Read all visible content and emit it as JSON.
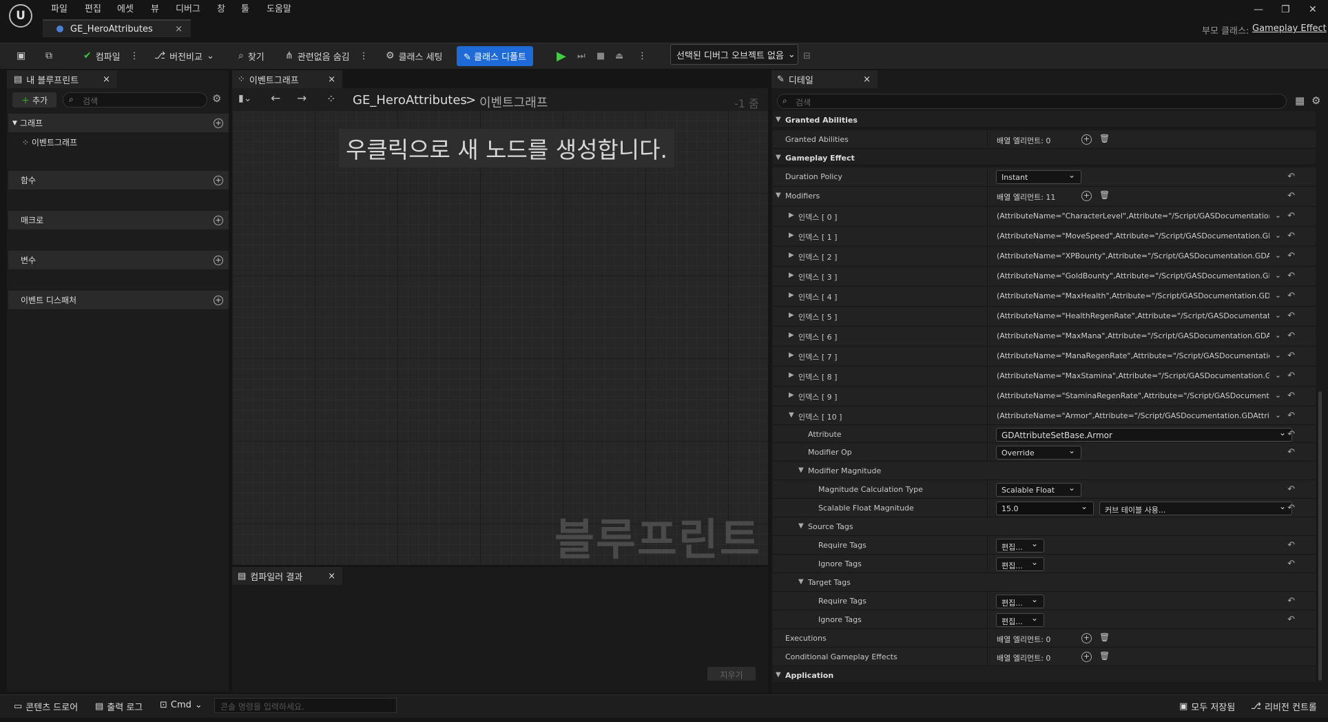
{
  "menu": [
    "파일",
    "편집",
    "에셋",
    "뷰",
    "디버그",
    "창",
    "툴",
    "도움말"
  ],
  "doc_tab": "GE_HeroAttributes",
  "parent_label": "부모 클래스:",
  "parent_value": "Gameplay Effect",
  "toolbar": {
    "compile": "컴파일",
    "diff": "버전비교",
    "find": "찾기",
    "hide_unrelated": "관련없음 숨김",
    "class_settings": "클래스 세팅",
    "class_defaults": "클래스 디폴트",
    "debug_select": "선택된 디버그 오브젝트 없음"
  },
  "left": {
    "tab": "내 블루프린트",
    "add": "추가",
    "search_placeholder": "검색",
    "graphs": "그래프",
    "event_graph": "이벤트그래프",
    "functions": "함수",
    "macros": "매크로",
    "variables": "변수",
    "dispatchers": "이벤트 디스패처"
  },
  "graph": {
    "tab": "이벤트그래프",
    "bc_root": "GE_HeroAttributes",
    "bc_sep": ">",
    "bc_leaf": "이벤트그래프",
    "zoom": "-1 줌",
    "hint": "우클릭으로 새 노드를 생성합니다.",
    "watermark": "블루프린트"
  },
  "compiler": {
    "tab": "컴파일러 결과",
    "clear": "지우기"
  },
  "details": {
    "tab": "디테일",
    "search_placeholder": "검색",
    "rows": [
      {
        "kind": "hdr",
        "label": "Granted Abilities"
      },
      {
        "kind": "arr",
        "label": "Granted Abilities",
        "value": "배열 엘리먼트: 0"
      },
      {
        "kind": "hdr",
        "label": "Gameplay Effect"
      },
      {
        "kind": "combo",
        "label": "Duration Policy",
        "value": "Instant"
      },
      {
        "kind": "arr",
        "label": "Modifiers",
        "value": "배열 엘리먼트: 11",
        "open": true
      },
      {
        "kind": "idx",
        "label": "인덱스 [ 0 ]",
        "value": "(AttributeName=\"CharacterLevel\",Attribute=\"/Script/GASDocumentation.GDAttr"
      },
      {
        "kind": "idx",
        "label": "인덱스 [ 1 ]",
        "value": "(AttributeName=\"MoveSpeed\",Attribute=\"/Script/GASDocumentation.GDAttribu"
      },
      {
        "kind": "idx",
        "label": "인덱스 [ 2 ]",
        "value": "(AttributeName=\"XPBounty\",Attribute=\"/Script/GASDocumentation.GDAttribute"
      },
      {
        "kind": "idx",
        "label": "인덱스 [ 3 ]",
        "value": "(AttributeName=\"GoldBounty\",Attribute=\"/Script/GASDocumentation.GDAttribut"
      },
      {
        "kind": "idx",
        "label": "인덱스 [ 4 ]",
        "value": "(AttributeName=\"MaxHealth\",Attribute=\"/Script/GASDocumentation.GDAttribut"
      },
      {
        "kind": "idx",
        "label": "인덱스 [ 5 ]",
        "value": "(AttributeName=\"HealthRegenRate\",Attribute=\"/Script/GASDocumentation.GDA"
      },
      {
        "kind": "idx",
        "label": "인덱스 [ 6 ]",
        "value": "(AttributeName=\"MaxMana\",Attribute=\"/Script/GASDocumentation.GDAttribute"
      },
      {
        "kind": "idx",
        "label": "인덱스 [ 7 ]",
        "value": "(AttributeName=\"ManaRegenRate\",Attribute=\"/Script/GASDocumentation.GDAt"
      },
      {
        "kind": "idx",
        "label": "인덱스 [ 8 ]",
        "value": "(AttributeName=\"MaxStamina\",Attribute=\"/Script/GASDocumentation.GDAttrib"
      },
      {
        "kind": "idx",
        "label": "인덱스 [ 9 ]",
        "value": "(AttributeName=\"StaminaRegenRate\",Attribute=\"/Script/GASDocumentation.GD"
      },
      {
        "kind": "idx",
        "label": "인덱스 [ 10 ]",
        "value": "(AttributeName=\"Armor\",Attribute=\"/Script/GASDocumentation.GDAttributeSetI",
        "open": true
      },
      {
        "kind": "wide",
        "label": "Attribute",
        "value": "GDAttributeSetBase.Armor",
        "indent": 1
      },
      {
        "kind": "combo",
        "label": "Modifier Op",
        "value": "Override",
        "indent": 1
      },
      {
        "kind": "sub",
        "label": "Modifier Magnitude",
        "indent": 1
      },
      {
        "kind": "combo",
        "label": "Magnitude Calculation Type",
        "value": "Scalable Float",
        "indent": 2
      },
      {
        "kind": "num",
        "label": "Scalable Float Magnitude",
        "value": "15.0",
        "extra": "커브 테이블 사용...",
        "indent": 2
      },
      {
        "kind": "sub",
        "label": "Source Tags",
        "indent": 1
      },
      {
        "kind": "edit",
        "label": "Require Tags",
        "value": "편집...",
        "indent": 2
      },
      {
        "kind": "edit",
        "label": "Ignore Tags",
        "value": "편집...",
        "indent": 2
      },
      {
        "kind": "sub",
        "label": "Target Tags",
        "indent": 1
      },
      {
        "kind": "edit",
        "label": "Require Tags",
        "value": "편집...",
        "indent": 2
      },
      {
        "kind": "edit",
        "label": "Ignore Tags",
        "value": "편집...",
        "indent": 2
      },
      {
        "kind": "arr",
        "label": "Executions",
        "value": "배열 엘리먼트: 0"
      },
      {
        "kind": "arr",
        "label": "Conditional Gameplay Effects",
        "value": "배열 엘리먼트: 0"
      },
      {
        "kind": "hdr",
        "label": "Application"
      }
    ]
  },
  "status": {
    "drawer": "콘텐츠 드로어",
    "log": "출력 로그",
    "cmd": "Cmd",
    "cmd_placeholder": "콘솔 명령을 입력하세요.",
    "save_all": "모두 저장됨",
    "revision": "리비전 컨트롤"
  }
}
